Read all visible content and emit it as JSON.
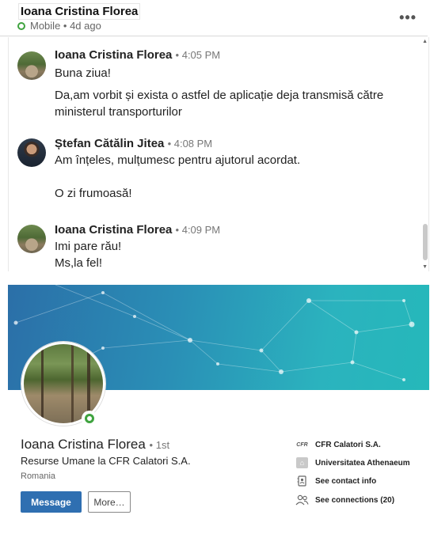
{
  "header": {
    "name": "Ioana Cristina Florea",
    "status": "Mobile • 4d ago",
    "more_icon": "more-horizontal-icon"
  },
  "messages": [
    {
      "sender": "Ioana Cristina Florea",
      "time": "• 4:05 PM",
      "lines": [
        "Buna ziua!",
        "Da,am vorbit și exista o astfel de aplicație deja transmisă către ministerul transporturilor"
      ]
    },
    {
      "sender": "Ștefan Cătălin Jitea",
      "time": "• 4:08 PM",
      "lines": [
        "Am înțeles, mulțumesc pentru ajutorul acordat.",
        "O zi frumoasă!"
      ]
    },
    {
      "sender": "Ioana Cristina Florea",
      "time": "• 4:09 PM",
      "lines": [
        "Imi pare rău!",
        "Ms,la fel!"
      ]
    }
  ],
  "profile": {
    "name": "Ioana Cristina Florea",
    "degree": "• 1st",
    "headline": "Resurse Umane la CFR Calatori S.A.",
    "location": "Romania",
    "message_button": "Message",
    "more_button": "More…",
    "info": {
      "company": "CFR Calatori S.A.",
      "company_logo_text": "CFR",
      "school": "Universitatea Athenaeum",
      "contact": "See contact info",
      "connections": "See connections (20)"
    }
  },
  "colors": {
    "accent": "#2f6fb1",
    "online": "#3fa33f"
  }
}
